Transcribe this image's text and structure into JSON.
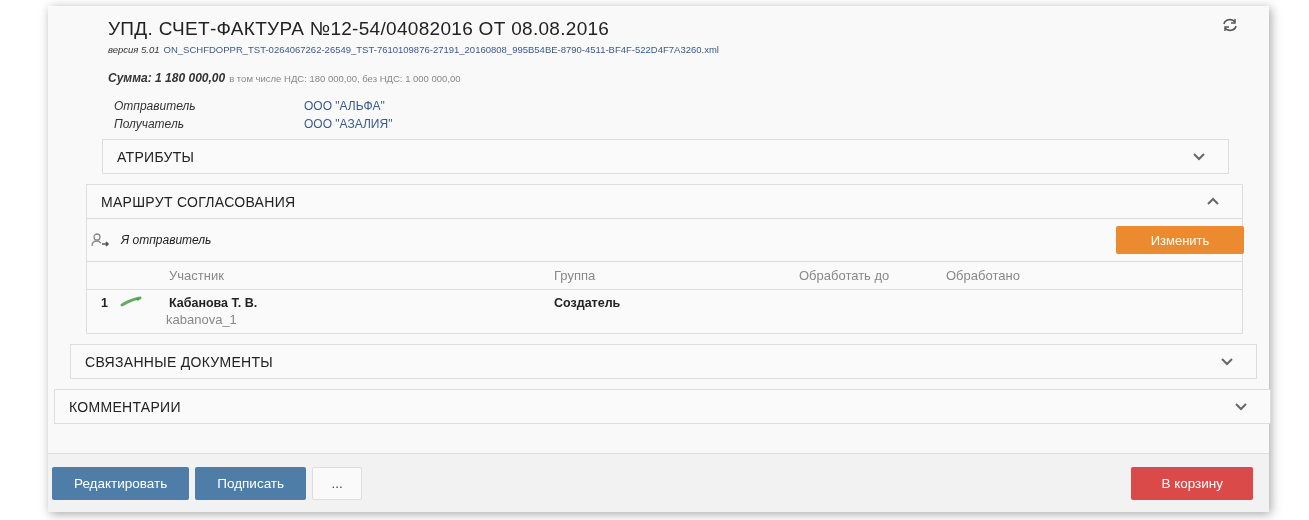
{
  "document": {
    "title": "УПД. СЧЕТ-ФАКТУРА №12-54/04082016 ОТ 08.08.2016",
    "version_label": "версия 5.01",
    "file_name": "ON_SCHFDOPPR_TST-0264067262-26549_TST-7610109876-27191_20160808_995B54BE-8790-4511-BF4F-522D4F7A3260.xml",
    "sum_label": "Сумма: 1 180 000,00",
    "sum_details": "в том числе НДС: 180 000,00, без НДС: 1 000 000,00",
    "parties": [
      {
        "label": "Отправитель",
        "value": "ООО \"АЛЬФА\""
      },
      {
        "label": "Получатель",
        "value": "ООО \"АЗАЛИЯ\""
      }
    ]
  },
  "sections": [
    {
      "title": "АТРИБУТЫ",
      "expanded": false
    },
    {
      "title": "МАРШРУТ СОГЛАСОВАНИЯ",
      "expanded": true,
      "kind": "route"
    },
    {
      "title": "СВЯЗАННЫЕ ДОКУМЕНТЫ",
      "expanded": false
    },
    {
      "title": "КОММЕНТАРИИ",
      "expanded": false
    }
  ],
  "route": {
    "sender_text": "Я отправитель",
    "change_button": "Изменить",
    "columns": [
      "Участник",
      "Группа",
      "Обработать до",
      "Обработано"
    ],
    "rows": [
      {
        "number": "1",
        "name": "Кабанова Т. В.",
        "login": "kabanova_1",
        "group": "Создатель"
      }
    ]
  },
  "footer": {
    "buttons": [
      {
        "label": "Редактировать",
        "kind": "primary"
      },
      {
        "label": "Подписать",
        "kind": "primary"
      },
      {
        "label": "...",
        "kind": "more"
      }
    ],
    "delete_button": "В корзину"
  }
}
